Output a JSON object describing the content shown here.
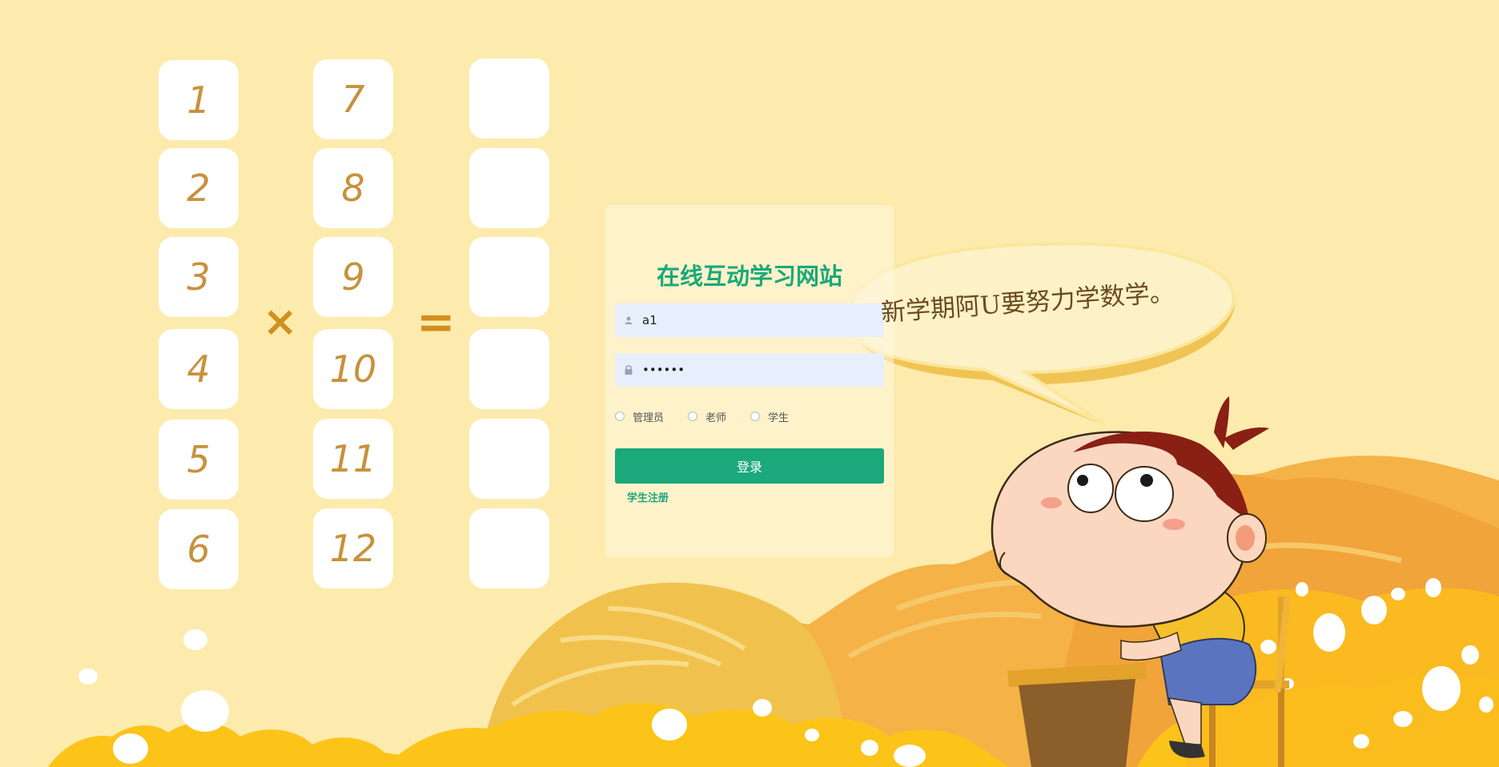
{
  "app": {
    "title": "在线互动学习网站"
  },
  "multiplication": {
    "left_numbers": [
      "1",
      "2",
      "3",
      "4",
      "5",
      "6"
    ],
    "right_numbers": [
      "7",
      "8",
      "9",
      "10",
      "11",
      "12"
    ],
    "times_symbol": "×",
    "equals_symbol": "="
  },
  "login": {
    "username_value": "a1",
    "password_value": "••••••",
    "roles": [
      {
        "label": "管理员"
      },
      {
        "label": "老师"
      },
      {
        "label": "学生"
      }
    ],
    "submit_label": "登录",
    "register_label": "学生注册"
  },
  "illustration": {
    "speech_text": "新学期阿U要努力学数学。"
  },
  "colors": {
    "background": "#fdebad",
    "accent": "#1ba87a",
    "card": "#ffffff",
    "number": "#c8913c"
  },
  "icons": {
    "username": "user-icon",
    "password": "lock-icon"
  }
}
